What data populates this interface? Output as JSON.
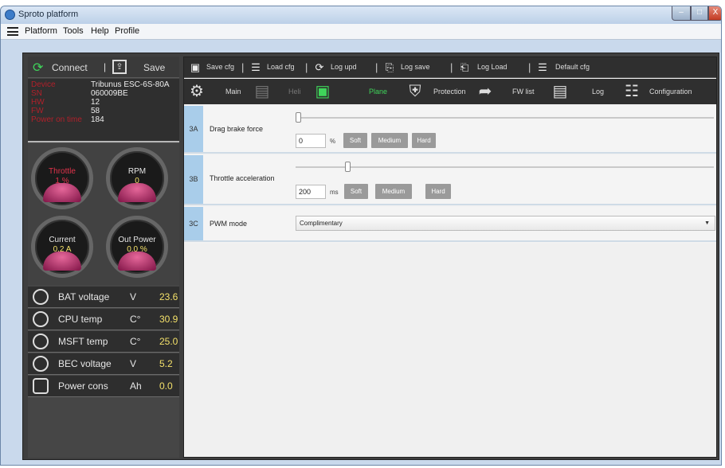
{
  "window": {
    "title": "Sproto platform",
    "controls": {
      "min": "–",
      "max": "□",
      "close": "X"
    }
  },
  "menu": [
    "Platform",
    "Tools",
    "Help",
    "Profile"
  ],
  "left": {
    "connect_label": "Connect",
    "separator": "|",
    "save_label": "Save",
    "info": [
      {
        "key": "Device",
        "value": "Tribunus ESC-6S-80A"
      },
      {
        "key": "SN",
        "value": "060009BE"
      },
      {
        "key": "HW",
        "value": "12"
      },
      {
        "key": "FW",
        "value": "58"
      },
      {
        "key": "Power on time",
        "value": "184"
      }
    ],
    "gauges": [
      {
        "label": "Throttle",
        "value": "1 %",
        "label_color": "#e2334b",
        "value_color": "#e2334b"
      },
      {
        "label": "RPM",
        "value": "0",
        "label_color": "#e6e6e6",
        "value_color": "#f3e06a"
      },
      {
        "label": "Current",
        "value": "0.2 A",
        "label_color": "#e6e6e6",
        "value_color": "#f3e06a"
      },
      {
        "label": "Out Power",
        "value": "0.0 %",
        "label_color": "#e6e6e6",
        "value_color": "#f3e06a"
      }
    ],
    "stats": [
      {
        "icon": "lightning-icon",
        "name": "BAT voltage",
        "unit": "V",
        "value": "23.6"
      },
      {
        "icon": "cpu-temp-icon",
        "name": "CPU temp",
        "unit": "C°",
        "value": "30.9"
      },
      {
        "icon": "mosfet-temp-icon",
        "name": "MSFT temp",
        "unit": "C°",
        "value": "25.0"
      },
      {
        "icon": "bec-icon",
        "name": "BEC voltage",
        "unit": "V",
        "value": "5.2"
      },
      {
        "icon": "battery-icon",
        "name": "Power cons",
        "unit": "Ah",
        "value": "0.0"
      }
    ]
  },
  "toolbar1": {
    "separator": "|",
    "items": [
      {
        "icon": "floppy-icon",
        "label": "Save cfg"
      },
      {
        "icon": "sliders-icon",
        "label": "Load cfg"
      },
      {
        "icon": "refresh-icon",
        "label": "Log upd"
      },
      {
        "icon": "log-save-icon",
        "label": "Log save"
      },
      {
        "icon": "log-load-icon",
        "label": "Log Load"
      },
      {
        "icon": "default-icon",
        "label": "Default cfg"
      }
    ]
  },
  "toolbar2": {
    "items": [
      {
        "icon": "gear-icon",
        "label": "Main",
        "state": "normal"
      },
      {
        "icon": "heli-icon",
        "label": "Heli",
        "state": "disabled"
      },
      {
        "icon": "plane-icon",
        "label": "Plane",
        "state": "active"
      },
      {
        "icon": "shield-icon",
        "label": "Protection",
        "state": "normal"
      },
      {
        "icon": "firmware-icon",
        "label": "FW list",
        "state": "normal"
      },
      {
        "icon": "clipboard-icon",
        "label": "Log",
        "state": "normal"
      },
      {
        "icon": "config-sliders-icon",
        "label": "Configuration",
        "state": "normal"
      }
    ]
  },
  "settings": {
    "drag_brake": {
      "code": "3A",
      "name": "Drag brake force",
      "value": "0",
      "unit": "%",
      "level": 0.0,
      "buttons": [
        "Soft",
        "Medium",
        "Hard"
      ]
    },
    "throttle_accel": {
      "code": "3B",
      "name": "Throttle acceleration",
      "value": "200",
      "unit": "ms",
      "level": 0.12,
      "buttons": [
        "Soft",
        "Medium",
        "Hard"
      ]
    },
    "pwm_mode": {
      "code": "3C",
      "name": "PWM mode",
      "selected": "Complimentary"
    }
  }
}
